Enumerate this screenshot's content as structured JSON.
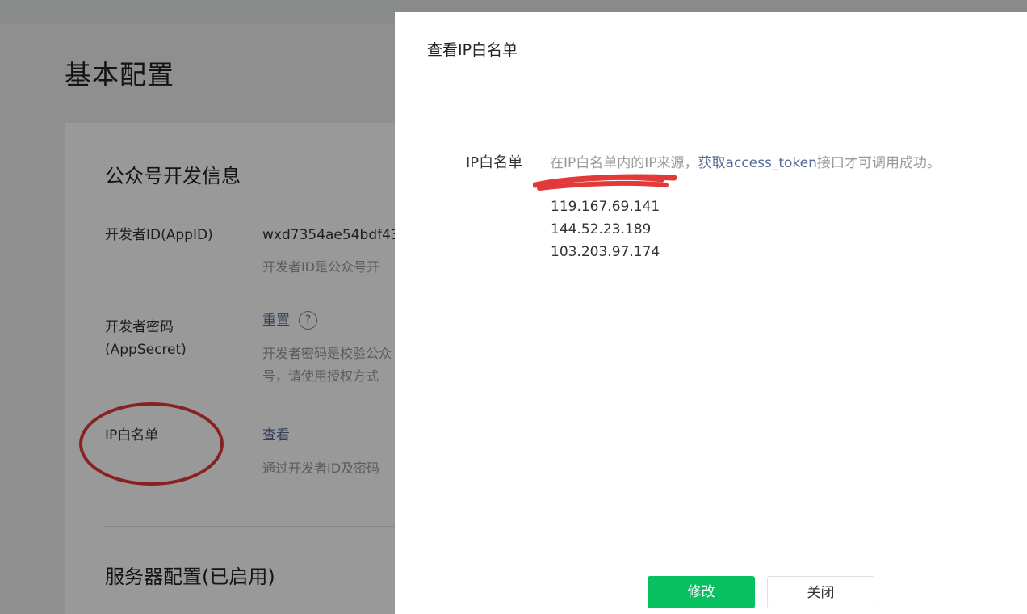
{
  "background": {
    "page_title": "基本配置",
    "section_dev": "公众号开发信息",
    "appid": {
      "label": "开发者ID(AppID)",
      "value": "wxd7354ae54bdf43",
      "desc": "开发者ID是公众号开"
    },
    "appsecret": {
      "label": "开发者密码(AppSecret)",
      "reset_link": "重置",
      "help_icon": "?",
      "desc_line1": "开发者密码是校验公众",
      "desc_line2": "号，请使用授权方式"
    },
    "ip_whitelist": {
      "label": "IP白名单",
      "view_link": "查看",
      "desc": "通过开发者ID及密码"
    },
    "section_server": "服务器配置(已启用)"
  },
  "modal": {
    "title": "查看IP白名单",
    "field_label": "IP白名单",
    "tip_prefix": "在IP白名单内的IP来源，",
    "tip_link": "获取access_token",
    "tip_suffix": "接口才可调用成功。",
    "ip_addresses": [
      "119.167.69.141",
      "144.52.23.189",
      "103.203.97.174"
    ],
    "buttons": {
      "modify": "修改",
      "close": "关闭"
    }
  },
  "colors": {
    "primary_green": "#07c160",
    "link_blue": "#576b95",
    "annotation_red": "#e23a3a"
  }
}
